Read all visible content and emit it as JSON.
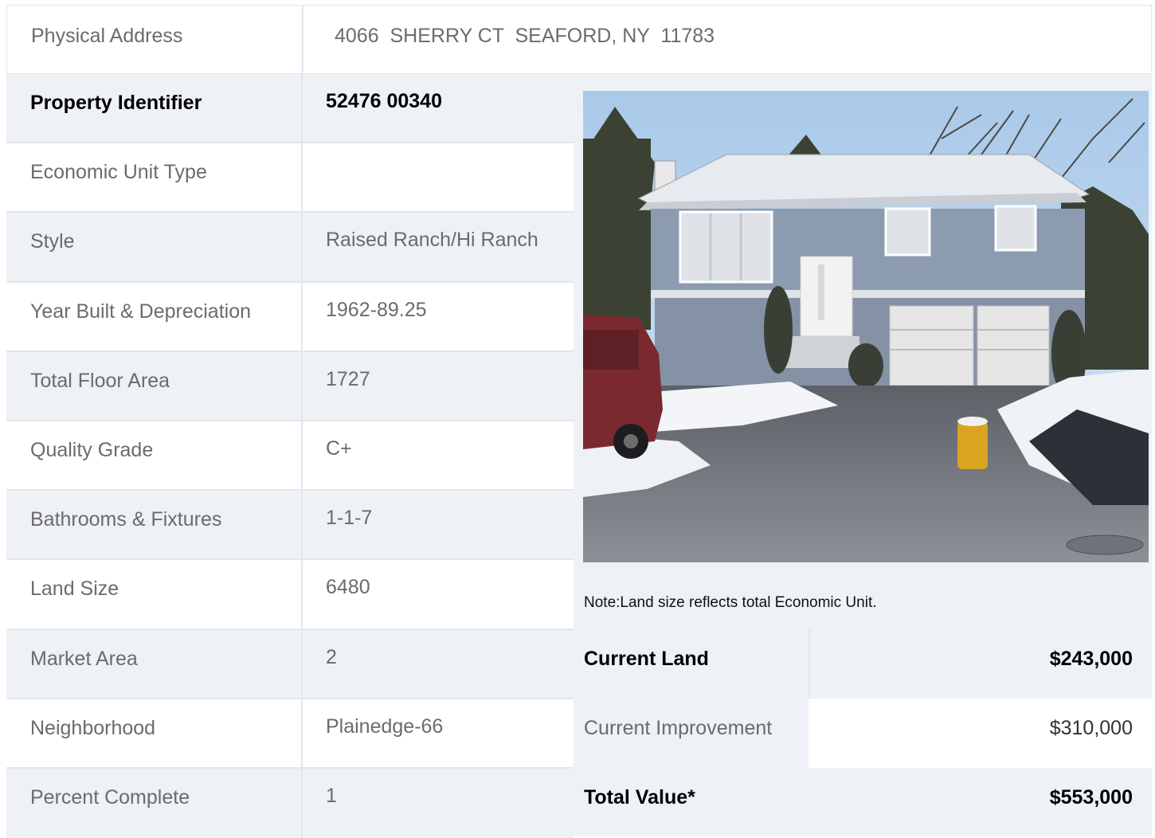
{
  "address": {
    "label": "Physical Address",
    "value": "4066  SHERRY CT  SEAFORD, NY  11783"
  },
  "details": [
    {
      "label": "Property Identifier",
      "value": "52476  00340"
    },
    {
      "label": "Economic Unit Type",
      "value": ""
    },
    {
      "label": "Style",
      "value": "Raised Ranch/Hi Ranch"
    },
    {
      "label": "Year Built & Depreciation",
      "value": "1962-89.25"
    },
    {
      "label": "Total Floor Area",
      "value": "1727"
    },
    {
      "label": "Quality Grade",
      "value": "C+"
    },
    {
      "label": "Bathrooms & Fixtures",
      "value": "1-1-7"
    },
    {
      "label": "Land Size",
      "value": "6480"
    },
    {
      "label": "Market Area",
      "value": "2"
    },
    {
      "label": "Neighborhood",
      "value": "Plainedge-66"
    },
    {
      "label": "Percent Complete",
      "value": "1"
    }
  ],
  "note": "Note:Land size reflects total Economic Unit.",
  "valuation": [
    {
      "label": "Current Land",
      "amount": "$243,000"
    },
    {
      "label": "Current Improvement",
      "amount": "$310,000"
    },
    {
      "label": "Total Value*",
      "amount": "$553,000"
    }
  ],
  "colors": {
    "row_shade": "#eef1f5",
    "border": "#e3e6ea",
    "label_text": "#6b6b6b",
    "house_siding": "#8d9bb0",
    "sky": "#b8d3ee"
  },
  "photo": {
    "subject": "property-photo"
  }
}
